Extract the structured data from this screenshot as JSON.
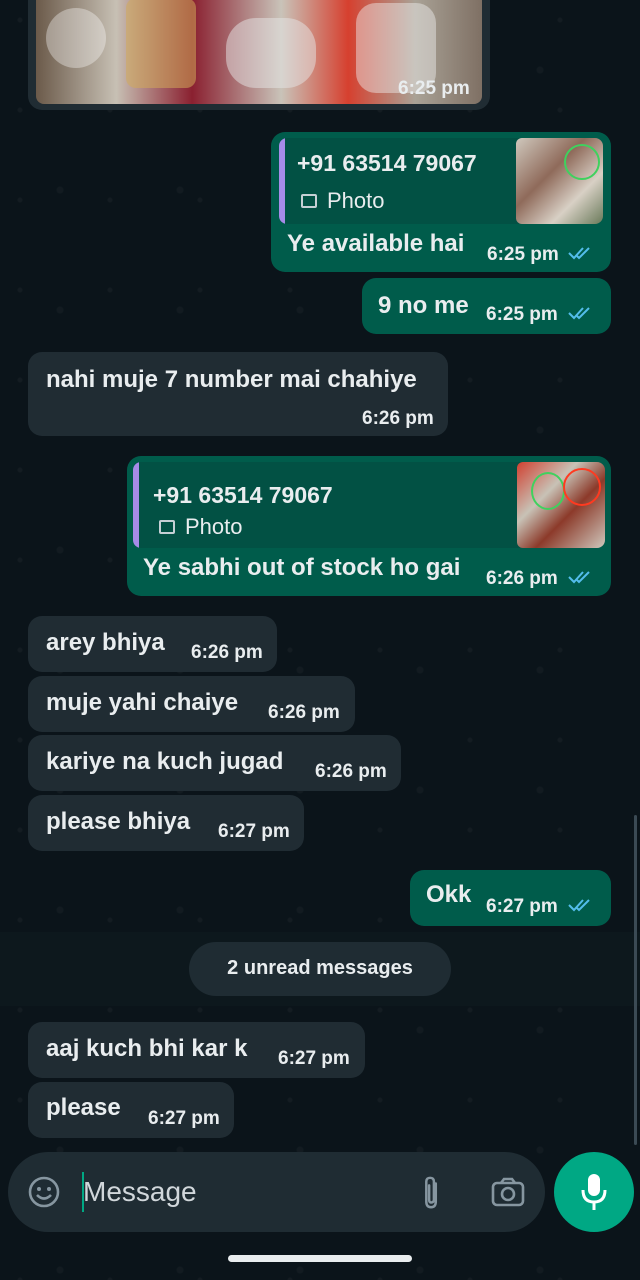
{
  "chat": {
    "top_image_time": "6:25 pm",
    "messages": [
      {
        "text": "Ye available hai",
        "time": "6:25 pm",
        "reply_phone": "+91 63514 79067",
        "reply_type": "Photo"
      },
      {
        "text": "9 no me",
        "time": "6:25 pm"
      },
      {
        "text": "nahi muje 7 number mai chahiye",
        "time": "6:26 pm"
      },
      {
        "text": "Ye sabhi out of stock ho gai",
        "time": "6:26 pm",
        "reply_phone": "+91 63514 79067",
        "reply_type": "Photo"
      },
      {
        "text": "arey bhiya",
        "time": "6:26 pm"
      },
      {
        "text": "muje yahi chaiye",
        "time": "6:26 pm"
      },
      {
        "text": "kariye na kuch jugad",
        "time": "6:26 pm"
      },
      {
        "text": "please bhiya",
        "time": "6:27 pm"
      },
      {
        "text": "Okk",
        "time": "6:27 pm"
      },
      {
        "text": "aaj kuch bhi kar k",
        "time": "6:27 pm"
      },
      {
        "text": "please",
        "time": "6:27 pm"
      }
    ],
    "unread_label": "2 unread messages"
  },
  "composer": {
    "placeholder": "Message"
  },
  "colors": {
    "background": "#0b141a",
    "incoming_bubble": "#202c33",
    "outgoing_bubble": "#005c4b",
    "accent": "#00a884",
    "read_ticks": "#53bdeb"
  },
  "icons": {
    "emoji": "emoji-icon",
    "attach": "paperclip-icon",
    "camera": "camera-icon",
    "mic": "mic-icon"
  }
}
